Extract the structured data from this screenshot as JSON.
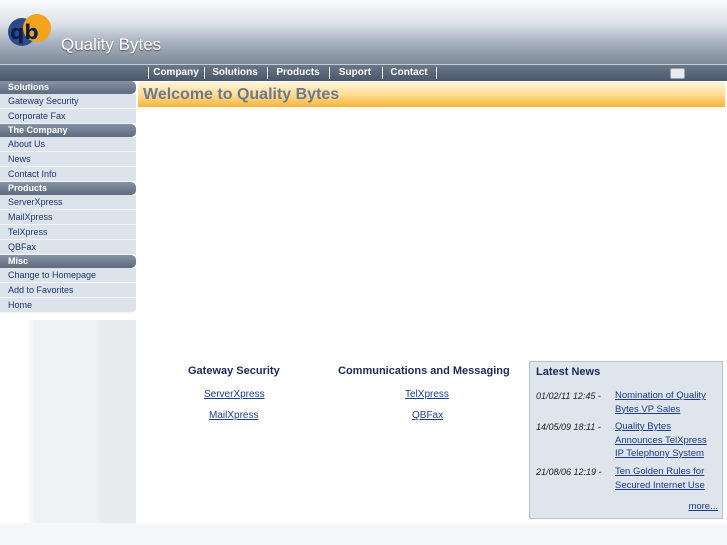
{
  "site": {
    "title": "Quality Bytes",
    "logo_text": "qb"
  },
  "topnav": [
    {
      "label": "Company"
    },
    {
      "label": "Solutions"
    },
    {
      "label": "Products"
    },
    {
      "label": "Suport"
    },
    {
      "label": "Contact"
    }
  ],
  "sidebar": [
    {
      "category": "Solutions",
      "items": [
        "Gateway Security",
        "Corporate Fax"
      ]
    },
    {
      "category": "The Company",
      "items": [
        "About Us",
        "News",
        "Contact Info"
      ]
    },
    {
      "category": "Products",
      "items": [
        "ServerXpress",
        "MailXpress",
        "TelXpress",
        "QBFax"
      ]
    },
    {
      "category": "Misc",
      "items": [
        "Change to Homepage",
        "Add to Favorites",
        "Home"
      ]
    }
  ],
  "main": {
    "heading": "Welcome to Quality Bytes",
    "sections": [
      {
        "title": "Gateway Security",
        "links": [
          "ServerXpress",
          "MailXpress"
        ]
      },
      {
        "title": "Communications and Messaging",
        "links": [
          "TelXpress",
          "QBFax"
        ]
      }
    ]
  },
  "news": {
    "title": "Latest News",
    "items": [
      {
        "date": "01/02/11 12:45 -",
        "text": "Nomination of Quality Bytes VP Sales"
      },
      {
        "date": "14/05/09 18:11 -",
        "text": "Quality Bytes Announces TelXpress IP Telephony System"
      },
      {
        "date": "21/08/06 12:19 -",
        "text": "Ten Golden Rules for Secured Internet Use"
      }
    ],
    "more": "more..."
  },
  "colors": {
    "accent": "#f7b43a",
    "nav": "#5f6c80",
    "link": "#1e3a8a"
  }
}
